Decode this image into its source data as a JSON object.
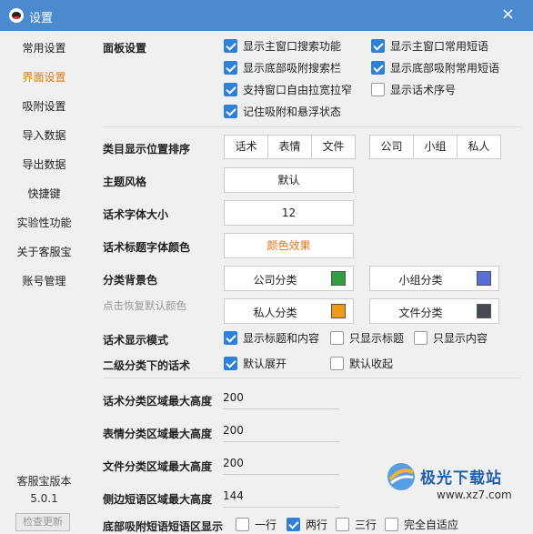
{
  "window": {
    "title": "设置",
    "close_glyph": "×"
  },
  "sidebar": {
    "items": [
      {
        "label": "常用设置",
        "active": false
      },
      {
        "label": "界面设置",
        "active": true
      },
      {
        "label": "吸附设置",
        "active": false
      },
      {
        "label": "导入数据",
        "active": false
      },
      {
        "label": "导出数据",
        "active": false
      },
      {
        "label": "快捷键",
        "active": false
      },
      {
        "label": "实验性功能",
        "active": false
      },
      {
        "label": "关于客服宝",
        "active": false
      },
      {
        "label": "账号管理",
        "active": false
      }
    ],
    "version_title": "客服宝版本",
    "version": "5.0.1",
    "update_button": "检查更新"
  },
  "panel": {
    "label": "面板设置",
    "options": [
      {
        "label": "显示主窗口搜索功能",
        "checked": true
      },
      {
        "label": "显示主窗口常用短语",
        "checked": true
      },
      {
        "label": "显示底部吸附搜索栏",
        "checked": true
      },
      {
        "label": "显示底部吸附常用短语",
        "checked": true
      },
      {
        "label": "支持窗口自由拉宽拉窄",
        "checked": true
      },
      {
        "label": "显示话术序号",
        "checked": false
      },
      {
        "label": "记住吸附和悬浮状态",
        "checked": true
      }
    ]
  },
  "category_order": {
    "label": "类目显示位置排序",
    "group1": [
      "话术",
      "表情",
      "文件"
    ],
    "group2": [
      "公司",
      "小组",
      "私人"
    ]
  },
  "theme": {
    "label": "主题风格",
    "value": "默认"
  },
  "font_size": {
    "label": "话术字体大小",
    "value": "12"
  },
  "title_color": {
    "label": "话术标题字体颜色",
    "value": "颜色效果",
    "color": "#e6761b"
  },
  "category_bg": {
    "label": "分类背景色",
    "reset_hint": "点击恢复默认颜色",
    "items": [
      {
        "label": "公司分类",
        "color": "#2e9e3e"
      },
      {
        "label": "小组分类",
        "color": "#5a6fd6"
      },
      {
        "label": "私人分类",
        "color": "#f29a11"
      },
      {
        "label": "文件分类",
        "color": "#454a52"
      }
    ]
  },
  "display_mode": {
    "label": "话术显示模式",
    "options": [
      {
        "label": "显示标题和内容",
        "checked": true
      },
      {
        "label": "只显示标题",
        "checked": false
      },
      {
        "label": "只显示内容",
        "checked": false
      }
    ]
  },
  "secondary": {
    "label": "二级分类下的话术",
    "options": [
      {
        "label": "默认展开",
        "checked": true
      },
      {
        "label": "默认收起",
        "checked": false
      }
    ]
  },
  "heights": [
    {
      "label": "话术分类区域最大高度",
      "value": "200"
    },
    {
      "label": "表情分类区域最大高度",
      "value": "200"
    },
    {
      "label": "文件分类区域最大高度",
      "value": "200"
    },
    {
      "label": "侧边短语区域最大高度",
      "value": "144"
    }
  ],
  "bottom_rows": {
    "label": "底部吸附短语短语区显示",
    "options": [
      {
        "label": "一行",
        "checked": false
      },
      {
        "label": "两行",
        "checked": true
      },
      {
        "label": "三行",
        "checked": false
      },
      {
        "label": "完全自适应",
        "checked": false
      }
    ]
  },
  "watermark": {
    "name": "极光下载站",
    "url": "www.xz7.com"
  },
  "colors": {
    "titlebar": "#4a8bcf",
    "accent": "#e07a1a",
    "checkbox": "#2f80d8"
  }
}
